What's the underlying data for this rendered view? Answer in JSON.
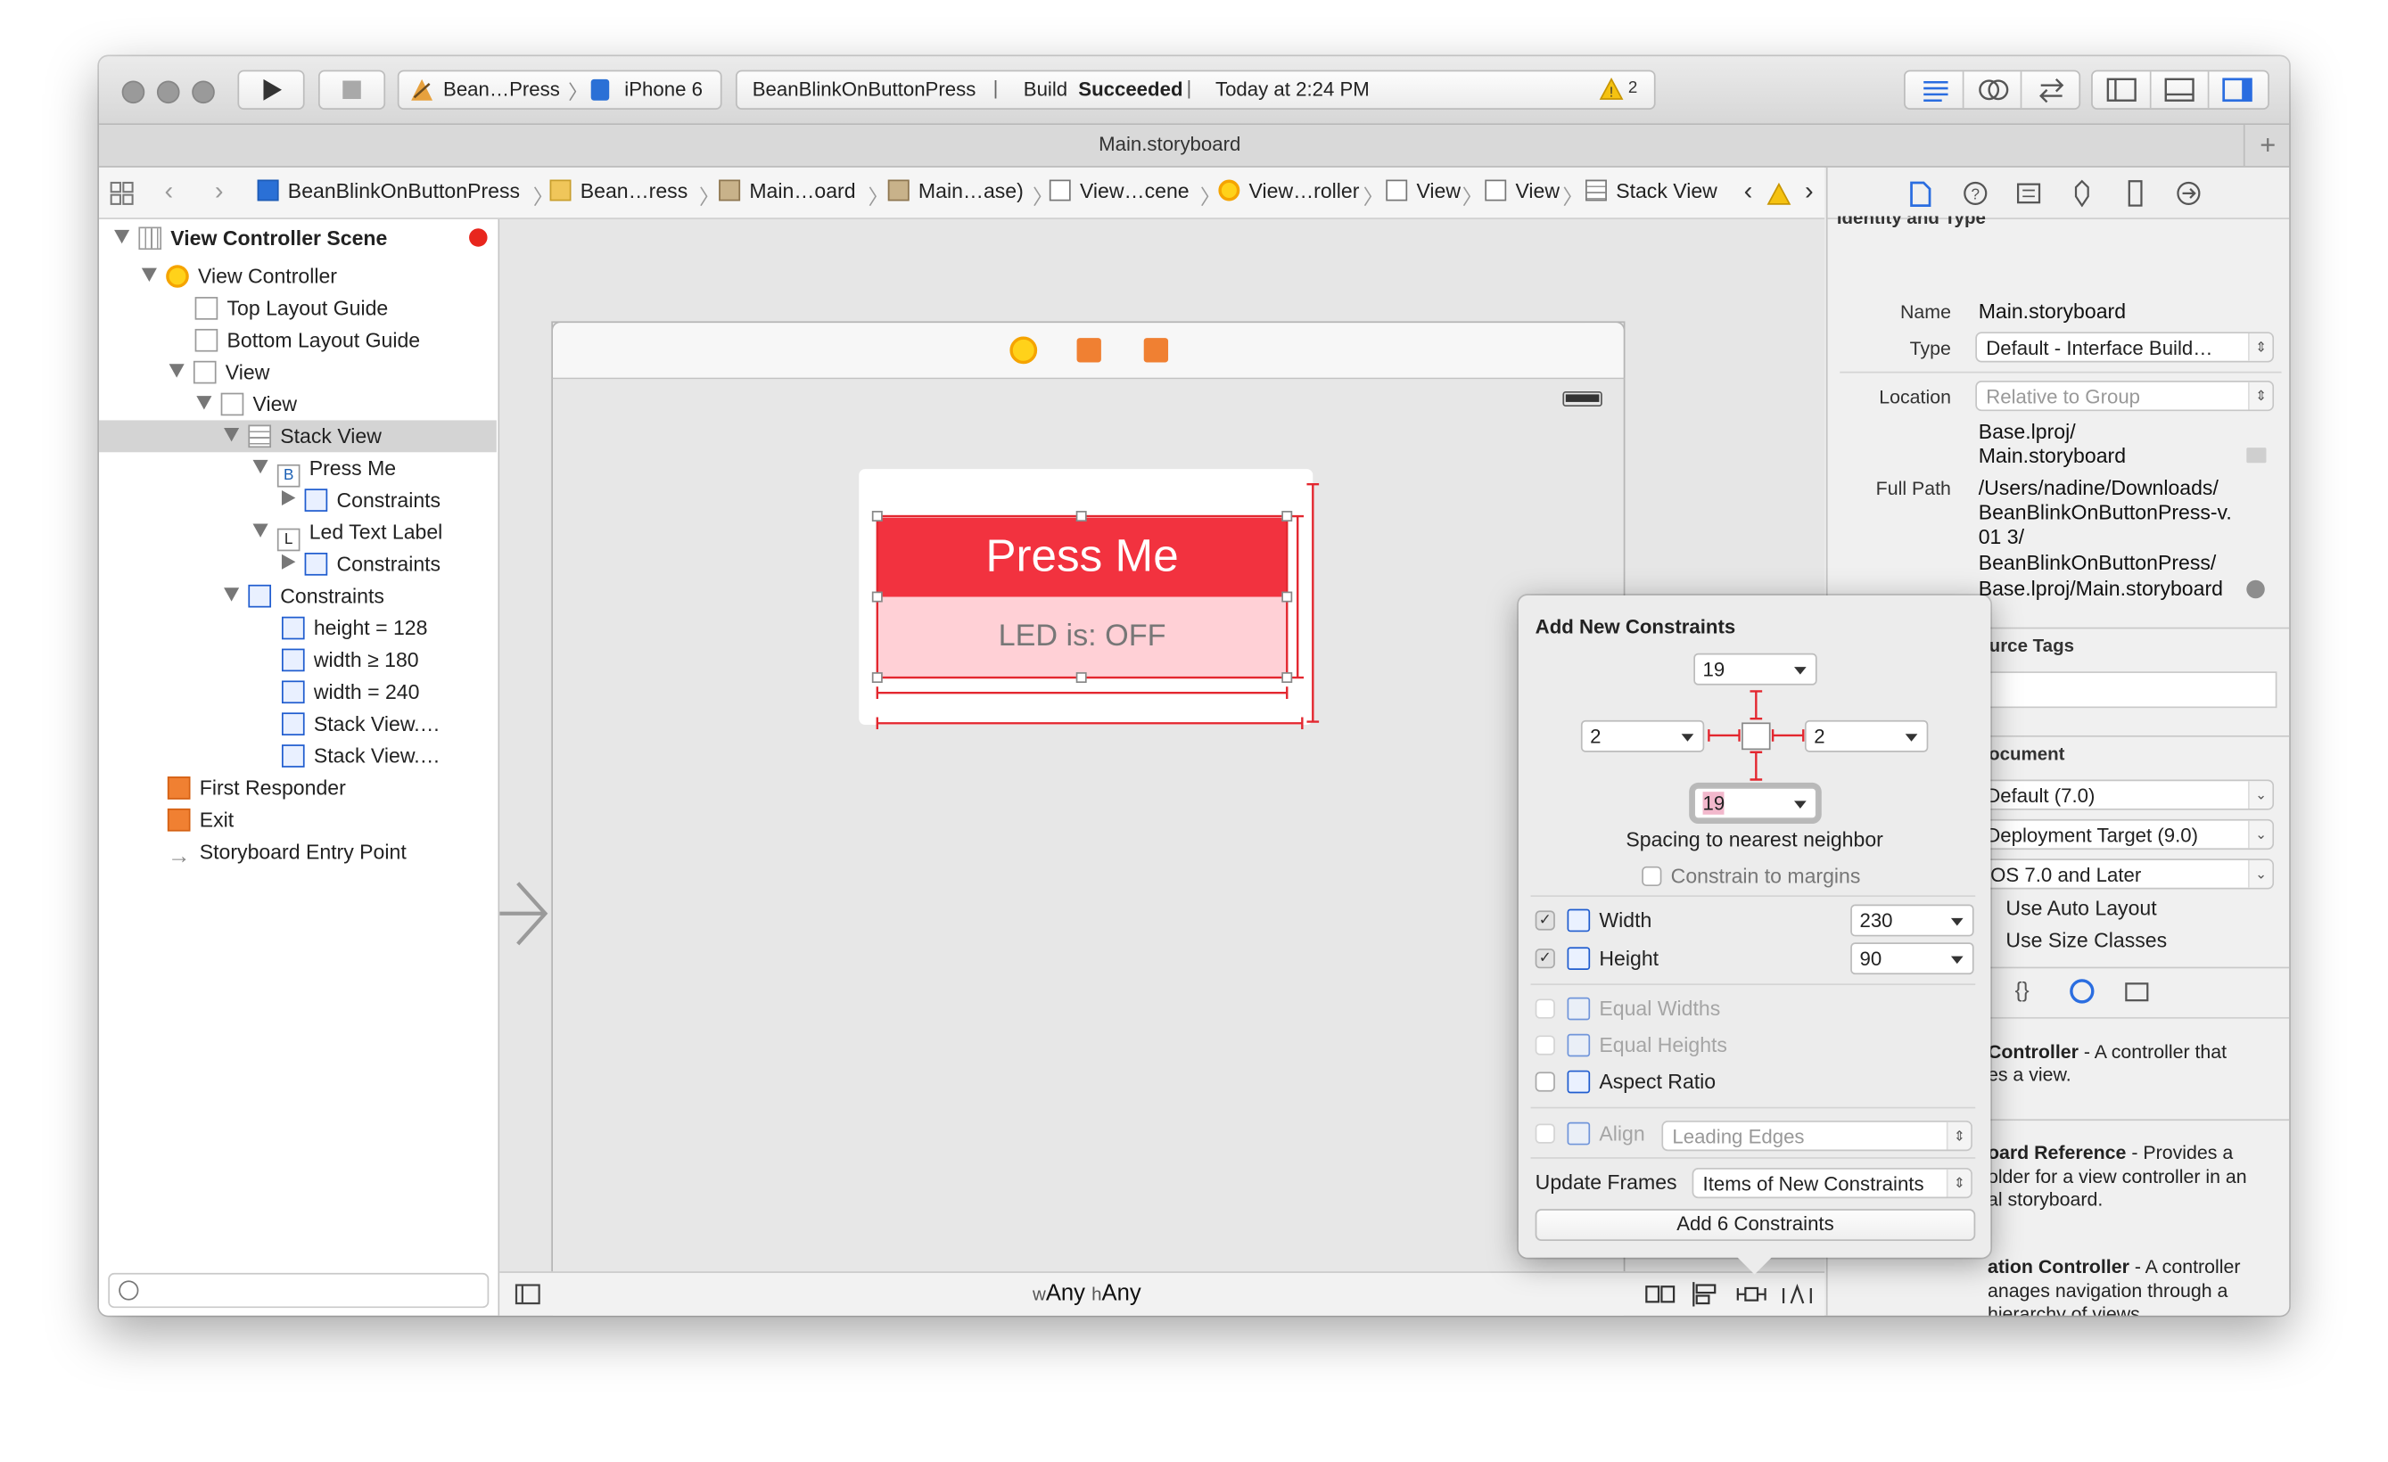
{
  "toolbar": {
    "scheme": "Bean…Press",
    "device": "iPhone 6",
    "activity_project": "BeanBlinkOnButtonPress",
    "activity_status_prefix": "Build",
    "activity_status": "Succeeded",
    "activity_time": "Today at 2:24 PM",
    "warning_count": "2"
  },
  "tab_title": "Main.storyboard",
  "jumpbar": {
    "crumbs": [
      "BeanBlinkOnButtonPress",
      "Bean…ress",
      "Main…oard",
      "Main…ase)",
      "View…cene",
      "View…roller",
      "View",
      "View",
      "Stack View"
    ]
  },
  "navigator": {
    "scene": "View Controller Scene",
    "items": [
      "View Controller",
      "Top Layout Guide",
      "Bottom Layout Guide",
      "View",
      "View",
      "Stack View",
      "Press Me",
      "Constraints",
      "Led Text Label",
      "Constraints",
      "Constraints",
      "height = 128",
      "width ≥ 180",
      "width = 240",
      "Stack View.…",
      "Stack View.…",
      "First Responder",
      "Exit",
      "Storyboard Entry Point"
    ],
    "button_letter": "B",
    "label_letter": "L"
  },
  "canvas": {
    "button_text": "Press Me",
    "label_text": "LED is: OFF",
    "size_class_w_prefix": "w",
    "size_class_w": "Any",
    "size_class_h_prefix": "h",
    "size_class_h": "Any"
  },
  "inspector": {
    "section_identity": "Identity and Type",
    "name_label": "Name",
    "name_value": "Main.storyboard",
    "type_label": "Type",
    "type_value": "Default - Interface Build…",
    "location_label": "Location",
    "location_value": "Relative to Group",
    "location_path_1": "Base.lproj/",
    "location_path_2": "Main.storyboard",
    "fullpath_label": "Full Path",
    "fullpath_1": "/Users/nadine/Downloads/",
    "fullpath_2": "BeanBlinkOnButtonPress-v.",
    "fullpath_3": "01 3/",
    "fullpath_4": "BeanBlinkOnButtonPress/",
    "fullpath_5": "Base.lproj/Main.storyboard",
    "section_odr": "On Demand Resource Tags",
    "section_doc": "Document",
    "doc_popup_1": "Default (7.0)",
    "doc_popup_2": "Deployment Target (9.0)",
    "doc_popup_3": "iOS 7.0 and Later",
    "use_auto_layout": "Use Auto Layout",
    "use_size_classes": "Use Size Classes",
    "lib_1_title": "Controller",
    "lib_1_desc_a": " - A controller that",
    "lib_1_desc_b": "es a view.",
    "lib_2_title": "oard Reference",
    "lib_2_desc_a": " - Provides a",
    "lib_2_desc_b": "older for a view controller in an",
    "lib_2_desc_c": "al storyboard.",
    "lib_3_title": "ation Controller",
    "lib_3_desc_a": " - A controller",
    "lib_3_desc_b": "anages navigation through a",
    "lib_3_desc_c": "hierarchy of views."
  },
  "popover": {
    "title": "Add New Constraints",
    "top": "19",
    "left": "2",
    "right": "2",
    "bottom": "19",
    "spacing_caption": "Spacing to nearest neighbor",
    "constrain_margins": "Constrain to margins",
    "width_label": "Width",
    "width_value": "230",
    "height_label": "Height",
    "height_value": "90",
    "equal_widths": "Equal Widths",
    "equal_heights": "Equal Heights",
    "aspect_ratio": "Aspect Ratio",
    "align_label": "Align",
    "align_value": "Leading Edges",
    "update_frames_label": "Update Frames",
    "update_frames_value": "Items of New Constraints",
    "add_button": "Add 6 Constraints"
  },
  "colors": {
    "press_me_bg": "#f2323f",
    "led_label_bg": "#ffd0d6",
    "constraint_red": "#e3272f",
    "accent_blue": "#1f5ccf"
  }
}
